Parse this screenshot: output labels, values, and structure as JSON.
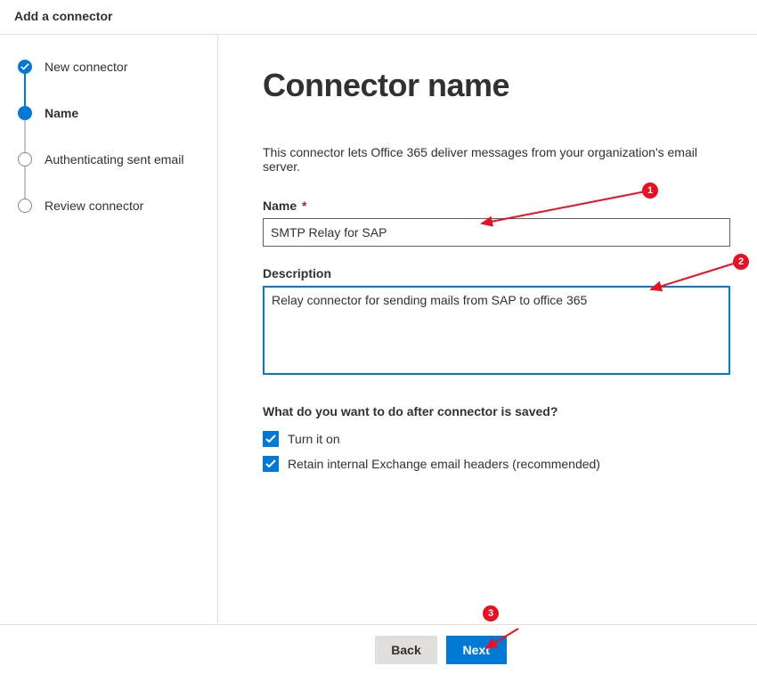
{
  "header": {
    "title": "Add a connector"
  },
  "steps": [
    {
      "label": "New connector",
      "state": "completed"
    },
    {
      "label": "Name",
      "state": "current"
    },
    {
      "label": "Authenticating sent email",
      "state": "upcoming"
    },
    {
      "label": "Review connector",
      "state": "upcoming"
    }
  ],
  "main": {
    "title": "Connector name",
    "intro": "This connector lets Office 365 deliver messages from your organization's email server.",
    "name_label": "Name",
    "name_required": "*",
    "name_value": "SMTP Relay for SAP",
    "description_label": "Description",
    "description_value": "Relay connector for sending mails from SAP to office 365",
    "post_save_question": "What do you want to do after connector is saved?",
    "checkbox_turn_on": "Turn it on",
    "checkbox_retain": "Retain internal Exchange email headers (recommended)"
  },
  "footer": {
    "back": "Back",
    "next": "Next"
  },
  "annotations": {
    "badge1": "1",
    "badge2": "2",
    "badge3": "3"
  }
}
